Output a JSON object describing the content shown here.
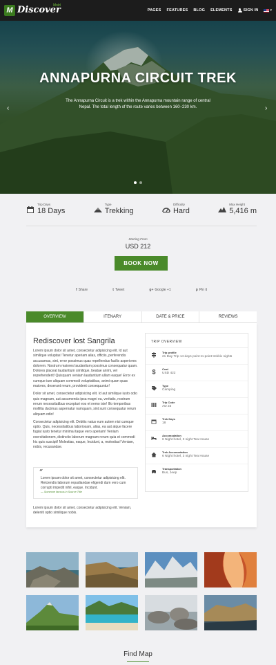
{
  "nav": {
    "logo_letter": "M",
    "logo_text": "Discover",
    "logo_sub": "Mold",
    "items": [
      "PAGES",
      "FEATURES",
      "BLOG",
      "ELEMENTS"
    ],
    "signin": "SIGN IN",
    "lang": "▾"
  },
  "hero": {
    "title": "ANNAPURNA CIRCUIT TREK",
    "description": "The Annapurna Circuit is a trek within the Annapurna mountain range of central Nepal. The total length of the route varies between 160–230 km.",
    "prev_icon": "chevron-left-icon",
    "next_icon": "chevron-right-icon",
    "slides": 2,
    "active_slide": 1
  },
  "facts": [
    {
      "icon": "calendar-icon",
      "label": "Trip Days",
      "value": "18 Days"
    },
    {
      "icon": "mountain-icon",
      "label": "Type",
      "value": "Trekking"
    },
    {
      "icon": "gauge-icon",
      "label": "Difficulty",
      "value": "Hard"
    },
    {
      "icon": "peak-icon",
      "label": "Max Height",
      "value": "5,416 m"
    }
  ],
  "booking": {
    "starting_from": "Starting From",
    "price": "USD 212",
    "button": "BOOK NOW"
  },
  "share": [
    {
      "icon": "f",
      "label": "Share"
    },
    {
      "icon": "t",
      "label": "Tweet"
    },
    {
      "icon": "g+",
      "label": "Google +1"
    },
    {
      "icon": "p",
      "label": "Pin it"
    }
  ],
  "tabs": [
    "OVERVIEW",
    "ITENARY",
    "DATE & PRICE",
    "REVIEWS"
  ],
  "content": {
    "heading": "Rediscover lost Sangrila",
    "paragraphs": [
      "Lorem ipsum dolor sit amet, consectetur adipisicing elit. Id aut similique voluptas! Tenetur aperiam alias, officiis, perferendis accusamus, sint, error possimus quas repellendus facilis asperiores dolorem. Nostrum maiores laudantium possimus consequatur quam. Dolores placeat laudantium similique, beatae animi, vel reprehenderit! Quisquam veniam laudantium ullam eaque! Error ex cumque iure aliquam commodi voluptatibus, animi quam quas maiores, deserunt rerum, provident consequuntur!",
      "Dolor sit amet, consectetur adipisicing elit. Id aut similique iusto odio quis magnam, aut assumenda ipsa magni ea, veritatis, nostrum rerum necessitatibus excepturi eos et nemo iste! Illo temporibus mollitia ducimus aspernatur numquam, sint sunt consequatur rerum aliquam odio!",
      "Consectetur adipisicing elit. Debitis natus eum autem nisi cumque optio. Quis, necessitatibus laboriosam, alias, ea aut atque facere fugiat iusto tenetur minima itaque vero aperiam! Veniam exercitationem, distinctio laborum magnam rerum quia et commodi hic quis suscipit! Molestias, eaque, Incidunt, a, molestias! Veniam, nobis, recusandae."
    ],
    "quote": "Lorem ipsum dolor sit amet, consectetur adipisicing elit. Reiciendis laborum repudiandae eligendi dum vero cum corrupti impedit nihil, eaque. Incidunt.",
    "quote_author": "— Someone famous in Source Title",
    "final": "Lorem ipsum dolor sit amet, consectetur adipisicing elit. Veniam, deleniti optio similique nobis."
  },
  "overview": {
    "title": "TRIP OVERVIEW",
    "rows": [
      {
        "icon": "signpost-icon",
        "label": "Trip profile",
        "value": "21 Day Trip 14 days point-to-point trekkiv nights"
      },
      {
        "icon": "dollar-icon",
        "label": "Cost",
        "value": "USD 422"
      },
      {
        "icon": "tag-icon",
        "label": "Type",
        "value": "Camping"
      },
      {
        "icon": "barcode-icon",
        "label": "Trip Code",
        "value": "AD 23"
      },
      {
        "icon": "calendar-icon",
        "label": "Trek Days",
        "value": "18"
      },
      {
        "icon": "bed-icon",
        "label": "Accomodation",
        "value": "6 Night hotel, 3 night Tea House"
      },
      {
        "icon": "house-icon",
        "label": "Trek Accomodation",
        "value": "6 Night hotel, 3 night Tea House"
      },
      {
        "icon": "car-icon",
        "label": "Transportation",
        "value": "Bus, Jeep"
      }
    ]
  },
  "gallery": [
    {
      "name": "coast-rocks-photo"
    },
    {
      "name": "coastal-cliff-photo"
    },
    {
      "name": "mountain-lake-photo"
    },
    {
      "name": "red-canyon-photo"
    },
    {
      "name": "green-peak-photo"
    },
    {
      "name": "tropical-beach-photo"
    },
    {
      "name": "boulder-shore-photo"
    },
    {
      "name": "cliff-sea-photo"
    }
  ],
  "find_map": "Find Map",
  "colors": {
    "accent": "#4a8a2a",
    "nav": "#1c1c1c",
    "page": "#f1f1f3"
  }
}
